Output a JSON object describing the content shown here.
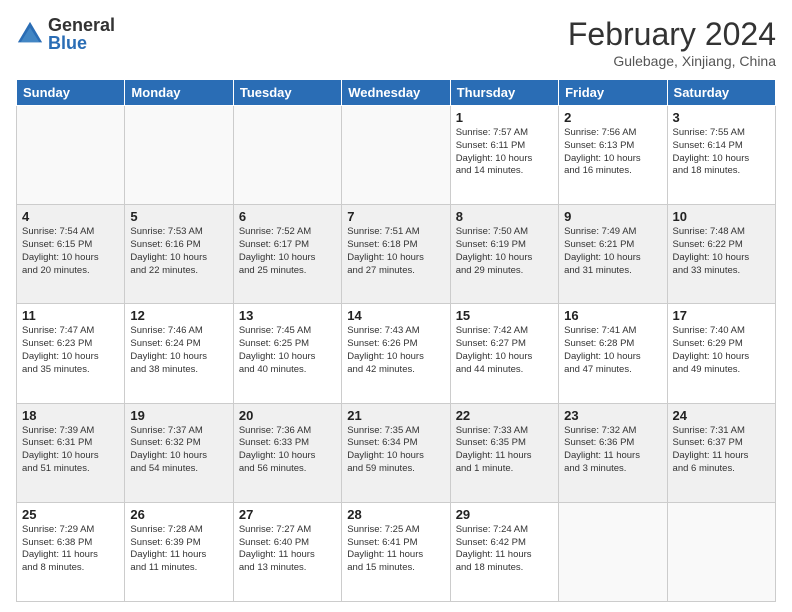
{
  "header": {
    "logo_general": "General",
    "logo_blue": "Blue",
    "title": "February 2024",
    "location": "Gulebage, Xinjiang, China"
  },
  "weekdays": [
    "Sunday",
    "Monday",
    "Tuesday",
    "Wednesday",
    "Thursday",
    "Friday",
    "Saturday"
  ],
  "weeks": [
    [
      {
        "day": "",
        "info": ""
      },
      {
        "day": "",
        "info": ""
      },
      {
        "day": "",
        "info": ""
      },
      {
        "day": "",
        "info": ""
      },
      {
        "day": "1",
        "info": "Sunrise: 7:57 AM\nSunset: 6:11 PM\nDaylight: 10 hours\nand 14 minutes."
      },
      {
        "day": "2",
        "info": "Sunrise: 7:56 AM\nSunset: 6:13 PM\nDaylight: 10 hours\nand 16 minutes."
      },
      {
        "day": "3",
        "info": "Sunrise: 7:55 AM\nSunset: 6:14 PM\nDaylight: 10 hours\nand 18 minutes."
      }
    ],
    [
      {
        "day": "4",
        "info": "Sunrise: 7:54 AM\nSunset: 6:15 PM\nDaylight: 10 hours\nand 20 minutes."
      },
      {
        "day": "5",
        "info": "Sunrise: 7:53 AM\nSunset: 6:16 PM\nDaylight: 10 hours\nand 22 minutes."
      },
      {
        "day": "6",
        "info": "Sunrise: 7:52 AM\nSunset: 6:17 PM\nDaylight: 10 hours\nand 25 minutes."
      },
      {
        "day": "7",
        "info": "Sunrise: 7:51 AM\nSunset: 6:18 PM\nDaylight: 10 hours\nand 27 minutes."
      },
      {
        "day": "8",
        "info": "Sunrise: 7:50 AM\nSunset: 6:19 PM\nDaylight: 10 hours\nand 29 minutes."
      },
      {
        "day": "9",
        "info": "Sunrise: 7:49 AM\nSunset: 6:21 PM\nDaylight: 10 hours\nand 31 minutes."
      },
      {
        "day": "10",
        "info": "Sunrise: 7:48 AM\nSunset: 6:22 PM\nDaylight: 10 hours\nand 33 minutes."
      }
    ],
    [
      {
        "day": "11",
        "info": "Sunrise: 7:47 AM\nSunset: 6:23 PM\nDaylight: 10 hours\nand 35 minutes."
      },
      {
        "day": "12",
        "info": "Sunrise: 7:46 AM\nSunset: 6:24 PM\nDaylight: 10 hours\nand 38 minutes."
      },
      {
        "day": "13",
        "info": "Sunrise: 7:45 AM\nSunset: 6:25 PM\nDaylight: 10 hours\nand 40 minutes."
      },
      {
        "day": "14",
        "info": "Sunrise: 7:43 AM\nSunset: 6:26 PM\nDaylight: 10 hours\nand 42 minutes."
      },
      {
        "day": "15",
        "info": "Sunrise: 7:42 AM\nSunset: 6:27 PM\nDaylight: 10 hours\nand 44 minutes."
      },
      {
        "day": "16",
        "info": "Sunrise: 7:41 AM\nSunset: 6:28 PM\nDaylight: 10 hours\nand 47 minutes."
      },
      {
        "day": "17",
        "info": "Sunrise: 7:40 AM\nSunset: 6:29 PM\nDaylight: 10 hours\nand 49 minutes."
      }
    ],
    [
      {
        "day": "18",
        "info": "Sunrise: 7:39 AM\nSunset: 6:31 PM\nDaylight: 10 hours\nand 51 minutes."
      },
      {
        "day": "19",
        "info": "Sunrise: 7:37 AM\nSunset: 6:32 PM\nDaylight: 10 hours\nand 54 minutes."
      },
      {
        "day": "20",
        "info": "Sunrise: 7:36 AM\nSunset: 6:33 PM\nDaylight: 10 hours\nand 56 minutes."
      },
      {
        "day": "21",
        "info": "Sunrise: 7:35 AM\nSunset: 6:34 PM\nDaylight: 10 hours\nand 59 minutes."
      },
      {
        "day": "22",
        "info": "Sunrise: 7:33 AM\nSunset: 6:35 PM\nDaylight: 11 hours\nand 1 minute."
      },
      {
        "day": "23",
        "info": "Sunrise: 7:32 AM\nSunset: 6:36 PM\nDaylight: 11 hours\nand 3 minutes."
      },
      {
        "day": "24",
        "info": "Sunrise: 7:31 AM\nSunset: 6:37 PM\nDaylight: 11 hours\nand 6 minutes."
      }
    ],
    [
      {
        "day": "25",
        "info": "Sunrise: 7:29 AM\nSunset: 6:38 PM\nDaylight: 11 hours\nand 8 minutes."
      },
      {
        "day": "26",
        "info": "Sunrise: 7:28 AM\nSunset: 6:39 PM\nDaylight: 11 hours\nand 11 minutes."
      },
      {
        "day": "27",
        "info": "Sunrise: 7:27 AM\nSunset: 6:40 PM\nDaylight: 11 hours\nand 13 minutes."
      },
      {
        "day": "28",
        "info": "Sunrise: 7:25 AM\nSunset: 6:41 PM\nDaylight: 11 hours\nand 15 minutes."
      },
      {
        "day": "29",
        "info": "Sunrise: 7:24 AM\nSunset: 6:42 PM\nDaylight: 11 hours\nand 18 minutes."
      },
      {
        "day": "",
        "info": ""
      },
      {
        "day": "",
        "info": ""
      }
    ]
  ]
}
